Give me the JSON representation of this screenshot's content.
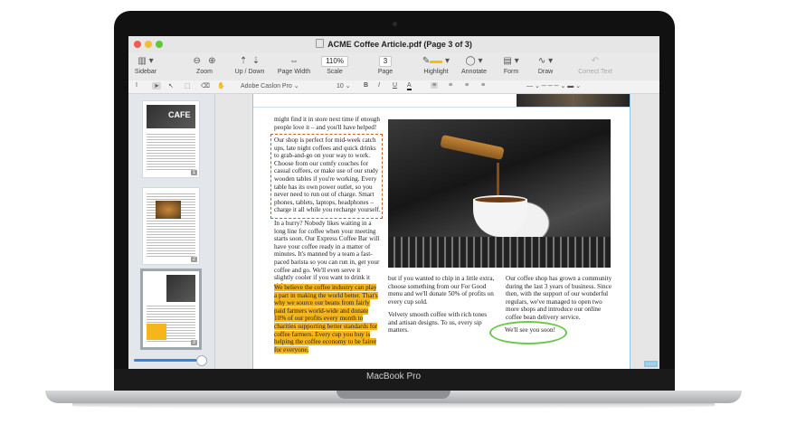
{
  "window": {
    "title": "ACME Coffee Article.pdf (Page 3 of 3)",
    "traffic_colors": [
      "#f25b4f",
      "#f6bb2e",
      "#5fc638"
    ]
  },
  "toolbar": {
    "sidebar": "Sidebar",
    "zoom": "Zoom",
    "up_down": "Up / Down",
    "page_width": "Page Width",
    "scale": "Scale",
    "scale_value": "110%",
    "page": "Page",
    "page_value": "3",
    "highlight": "Highlight",
    "annotate": "Annotate",
    "form": "Form",
    "draw": "Draw",
    "correct_text": "Correct Text"
  },
  "formatbar": {
    "font": "Adobe Caslon Pro",
    "size": "10",
    "bold": "B",
    "italic": "I",
    "underline": "U",
    "color": "A"
  },
  "sidebar": {
    "thumbs": [
      {
        "page": "1",
        "label": "CAFE"
      },
      {
        "page": "2"
      },
      {
        "page": "3"
      }
    ],
    "zoom_level": 0.92
  },
  "article": {
    "col1_top": "might find it in store next time if enough people love it – and you'll have helped!",
    "col1_box": "Our shop is perfect for mid-week catch ups, late night coffees and quick drinks to grab-and-go on your way to work. Choose from our comfy couches for casual coffees, or make use of our study wooden tables if you're working. Every table has its own power outlet, so you never need to run out of charge. Smart phones, tablets, laptops, headphones – charge it all while you recharge yourself.",
    "col1_mid": "In a hurry? Nobody likes waiting in a long line for coffee when your meeting starts soon. Our Express Coffee Bar will have your coffee ready in a matter of minutes. It's manned by a team a fast-paced barista so you can run in, get your coffee and go. We'll even serve it slightly cooler if you want to drink it right away.",
    "col1_highlight": "We believe the coffee industry can play a part in making the world better. That's why we source our beans from fairly paid farmers world-wide and donate 10% of our profits every month to charities supporting better standards for coffee farmers. Every cup you buy is helping the coffee economy to be fairer for everyone,",
    "col2_a": "but if you wanted to chip in a little extra, choose something from our For Good menu and we'll donate 50% of profits on every cup sold.",
    "col2_b": "Velvety smooth coffee with rich tones and artisan designs. To us, every sip matters.",
    "col3_a": "Our coffee shop has grown a community during the last 3 years of business. Since then, with the support of our wonderful regulars, we've managed to open two more shops and introduce our online coffee bean delivery service.",
    "col3_b": "We'll see you soon!"
  },
  "device": {
    "label": "MacBook Pro"
  }
}
